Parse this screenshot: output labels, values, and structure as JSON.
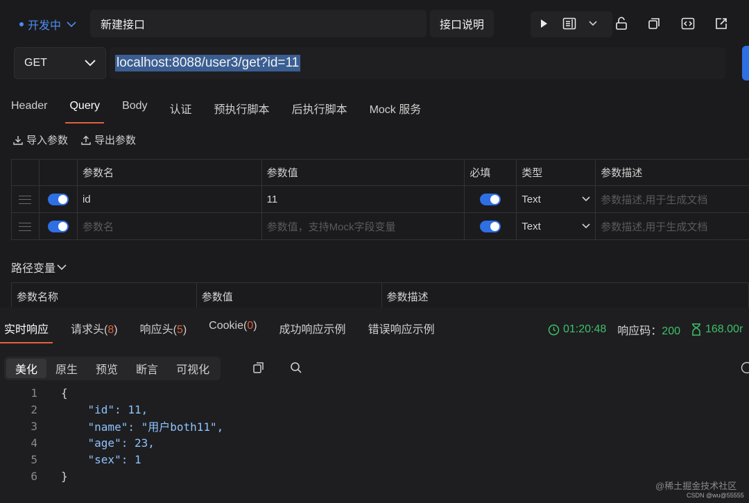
{
  "header": {
    "status": "开发中",
    "api_name": "新建接口",
    "desc_button": "接口说明",
    "icons": [
      "play-icon",
      "doc-icon",
      "chevron-down-icon",
      "lock-icon",
      "copy-icon",
      "code-icon",
      "share-icon"
    ]
  },
  "request": {
    "method": "GET",
    "url": "localhost:8088/user3/get?id=11"
  },
  "tabs": [
    "Header",
    "Query",
    "Body",
    "认证",
    "预执行脚本",
    "后执行脚本",
    "Mock 服务"
  ],
  "active_tab": "Query",
  "actions": {
    "import": "导入参数",
    "export": "导出参数"
  },
  "params": {
    "headers": [
      "参数名",
      "参数值",
      "必填",
      "类型",
      "参数描述"
    ],
    "rows": [
      {
        "name": "id",
        "value": "11",
        "type": "Text",
        "desc_placeholder": "参数描述,用于生成文档",
        "enabled": true,
        "required": true
      },
      {
        "name_placeholder": "参数名",
        "value_placeholder": "参数值，支持Mock字段变量",
        "type": "Text",
        "desc_placeholder": "参数描述,用于生成文档",
        "enabled": true,
        "required": true
      }
    ]
  },
  "path_vars": {
    "title": "路径变量",
    "headers": [
      "参数名称",
      "参数值",
      "参数描述"
    ]
  },
  "response": {
    "tabs": {
      "realtime": "实时响应",
      "req_headers": "请求头",
      "req_headers_count": "8",
      "resp_headers": "响应头",
      "resp_headers_count": "5",
      "cookie": "Cookie",
      "cookie_count": "0",
      "success_example": "成功响应示例",
      "error_example": "错误响应示例"
    },
    "time": "01:20:48",
    "status_label": "响应码：",
    "status_code": "200",
    "duration": "168.00r",
    "view_tabs": [
      "美化",
      "原生",
      "预览",
      "断言",
      "可视化"
    ],
    "code_lines": [
      "{",
      "    \"id\": 11,",
      "    \"name\": \"用户both11\",",
      "    \"age\": 23,",
      "    \"sex\": 1",
      "}"
    ]
  },
  "watermark": {
    "community": "@稀土掘金技术社区",
    "csdn": "CSDN @wu@55555"
  }
}
